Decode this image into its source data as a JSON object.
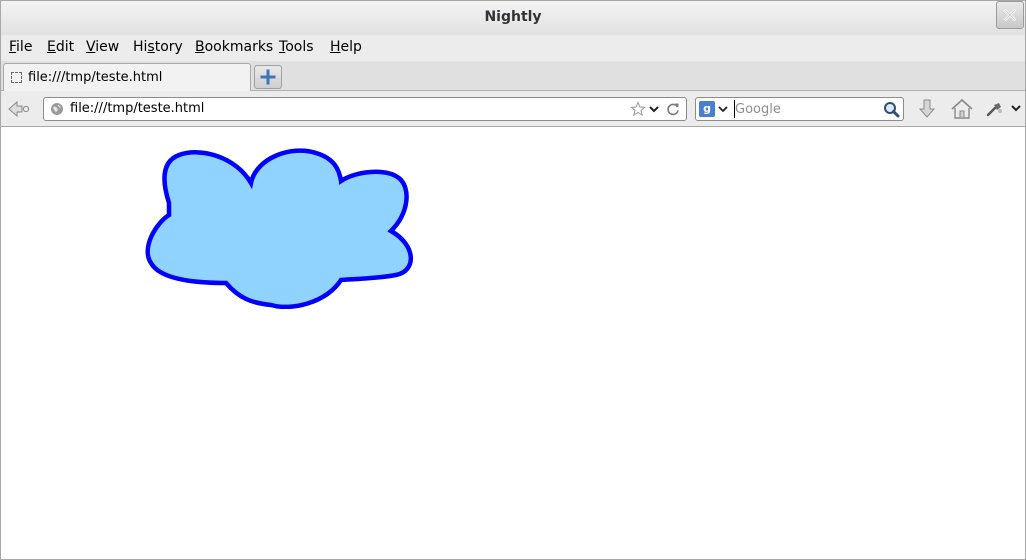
{
  "window": {
    "title": "Nightly"
  },
  "menu": [
    "File",
    "Edit",
    "View",
    "History",
    "Bookmarks",
    "Tools",
    "Help"
  ],
  "menu_mnemonics": [
    "F",
    "E",
    "V",
    "s",
    "B",
    "T",
    "H"
  ],
  "tab": {
    "title": "file:///tmp/teste.html"
  },
  "urlbar": {
    "value": "file:///tmp/teste.html"
  },
  "search": {
    "engine": "Google",
    "placeholder": "Google",
    "engine_icon_letter": "g"
  },
  "icons": {
    "back": "back-arrow-icon",
    "globe": "globe-icon",
    "star": "bookmark-star-icon",
    "reload": "reload-icon",
    "search": "magnifier-icon",
    "downloads": "download-arrow-icon",
    "home": "home-icon",
    "devtools": "developer-tools-icon"
  },
  "colors": {
    "cloud_fill": "#8fd3fe",
    "cloud_stroke": "#0000ff"
  }
}
